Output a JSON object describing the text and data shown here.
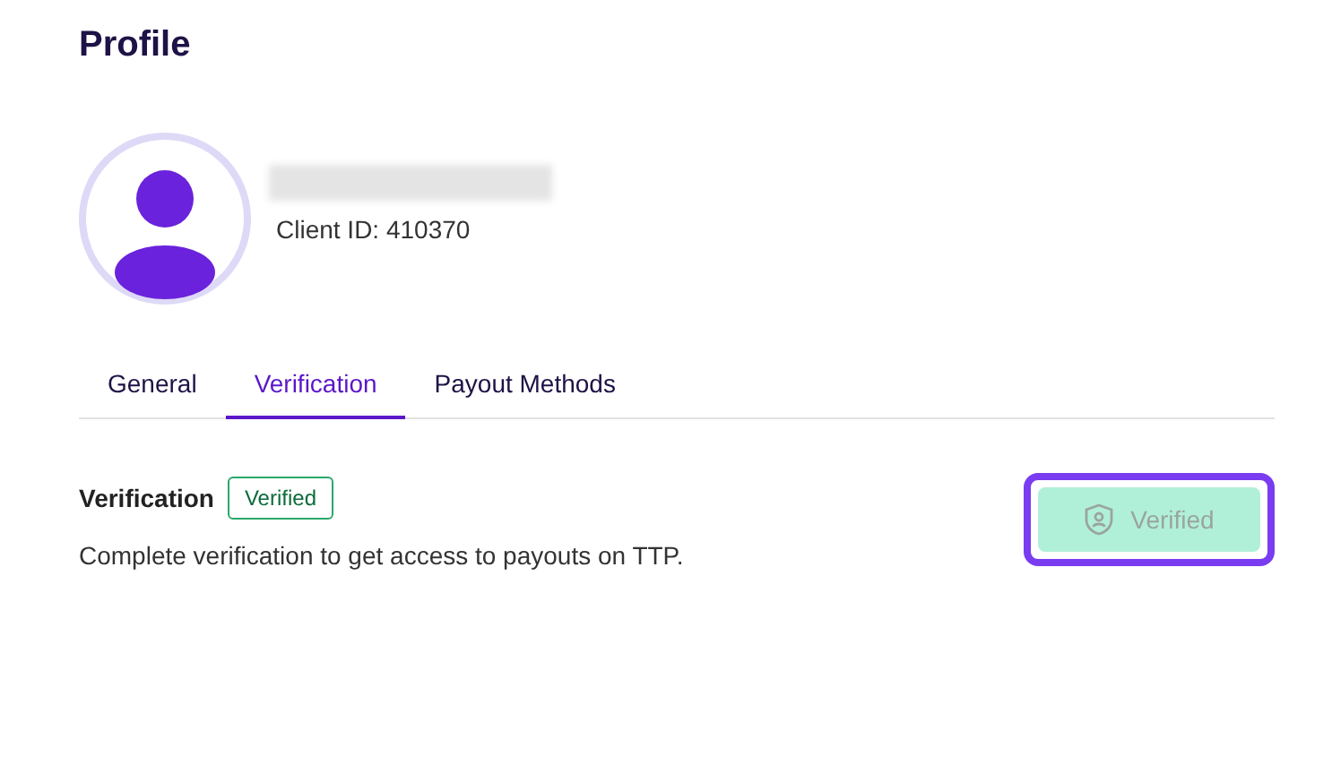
{
  "page": {
    "title": "Profile"
  },
  "profile": {
    "client_id": "Client ID: 410370"
  },
  "tabs": [
    {
      "label": "General",
      "selected": false
    },
    {
      "label": "Verification",
      "selected": true
    },
    {
      "label": "Payout Methods",
      "selected": false
    }
  ],
  "verification": {
    "title": "Verification",
    "badge": "Verified",
    "description": "Complete verification to get access to payouts on TTP.",
    "button": {
      "label": "Verified",
      "disabled": true,
      "highlighted": true
    }
  }
}
